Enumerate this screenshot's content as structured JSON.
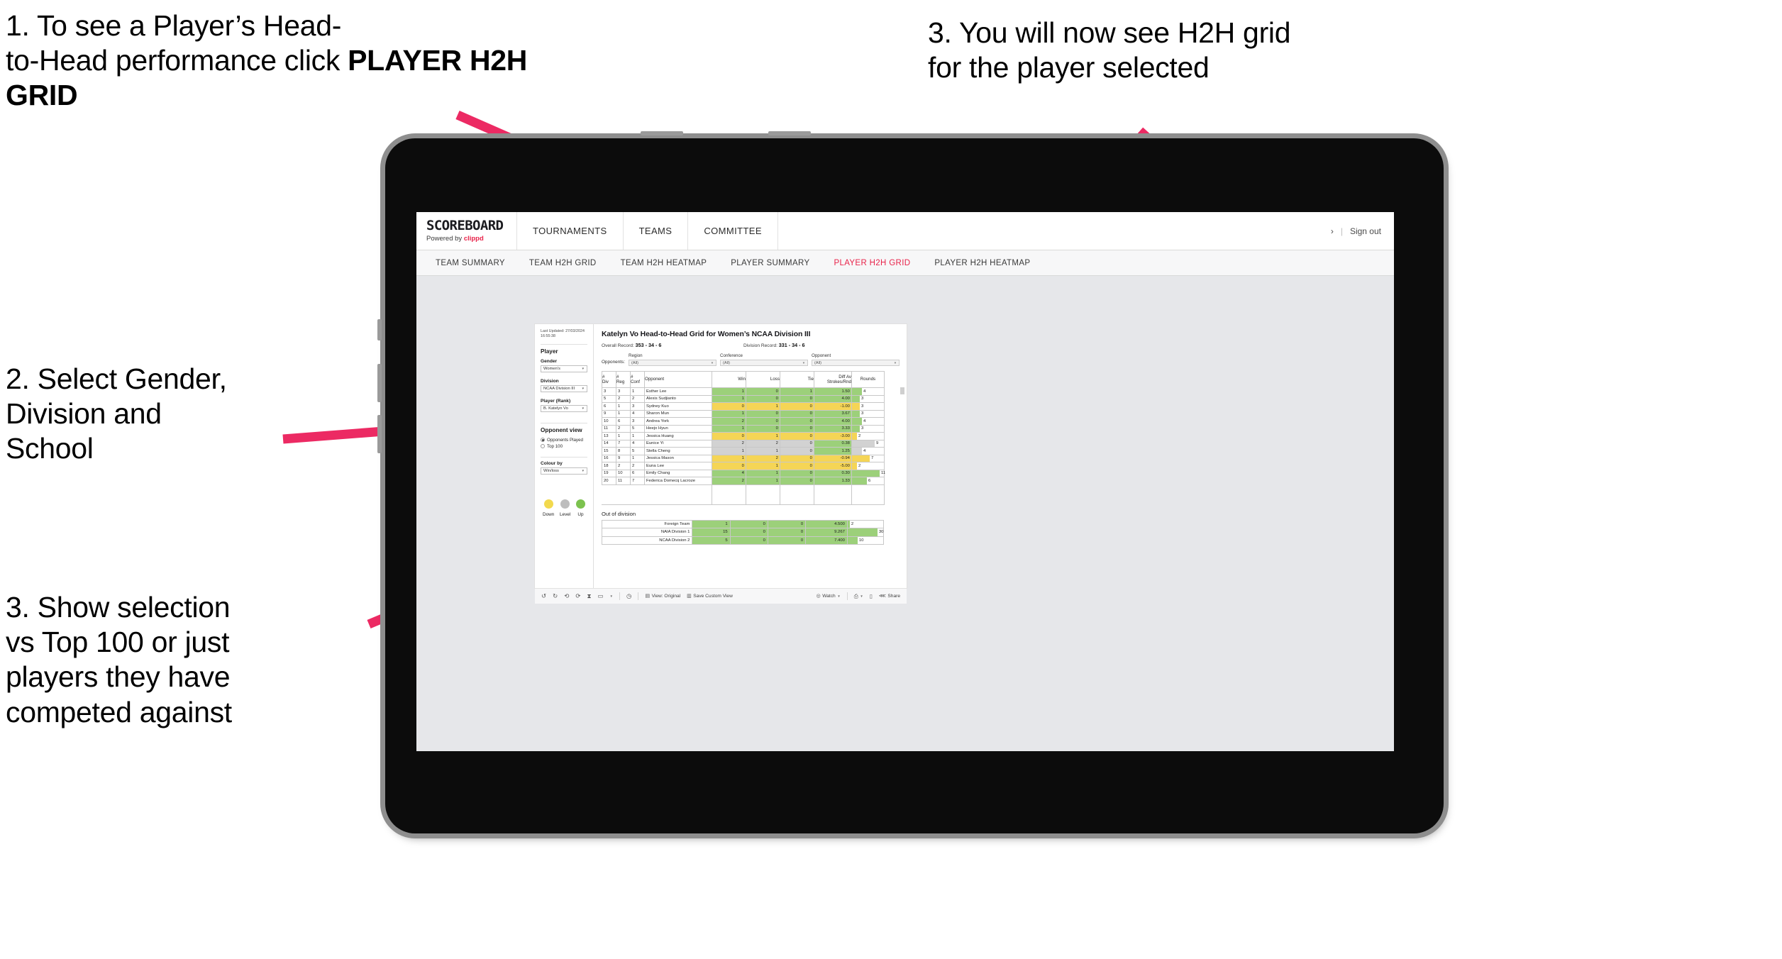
{
  "annotations": {
    "a1_line1": "1. To see a Player’s Head-\nto-Head performance click ",
    "a1_bold": "PLAYER H2H GRID",
    "a2": "2. Select Gender,\nDivision and\nSchool",
    "a3": "3. Show selection\nvs Top 100 or just\nplayers they have\ncompeted against",
    "a4": "3. You will now see H2H grid\nfor the player selected"
  },
  "brand": {
    "name": "SCOREBOARD",
    "powered_prefix": "Powered by ",
    "powered_brand": "clippd"
  },
  "topnav": {
    "items": [
      "TOURNAMENTS",
      "TEAMS",
      "COMMITTEE"
    ],
    "chevron": "›",
    "separator": "|",
    "signout": "Sign out"
  },
  "tabs": [
    {
      "label": "TEAM SUMMARY",
      "active": false
    },
    {
      "label": "TEAM H2H GRID",
      "active": false
    },
    {
      "label": "TEAM H2H HEATMAP",
      "active": false
    },
    {
      "label": "PLAYER SUMMARY",
      "active": false
    },
    {
      "label": "PLAYER H2H GRID",
      "active": true
    },
    {
      "label": "PLAYER H2H HEATMAP",
      "active": false
    }
  ],
  "panel": {
    "last_updated": "Last Updated: 27/03/2024 16:55:38",
    "section_player": "Player",
    "gender_label": "Gender",
    "gender_value": "Women's",
    "division_label": "Division",
    "division_value": "NCAA Division III",
    "player_label": "Player (Rank)",
    "player_value": "B. Katelyn Vo",
    "opponent_view_label": "Opponent view",
    "radio_played": "Opponents Played",
    "radio_top100": "Top 100",
    "colour_by_label": "Colour by",
    "colour_by_value": "Win/loss",
    "legend": [
      {
        "name": "Down",
        "color": "#f2d94e"
      },
      {
        "name": "Level",
        "color": "#bdbdbd"
      },
      {
        "name": "Up",
        "color": "#7cc24f"
      }
    ]
  },
  "viz": {
    "title": "Katelyn Vo Head-to-Head Grid for Women’s NCAA Division III",
    "overall_label": "Overall Record: ",
    "overall_value": "353 - 34 - 6",
    "division_label": "Division Record: ",
    "division_value": "331 - 34 - 6",
    "opponents_label": "Opponents:",
    "filters": [
      {
        "label": "Region",
        "value": "(All)"
      },
      {
        "label": "Conference",
        "value": "(All)"
      },
      {
        "label": "Opponent",
        "value": "(All)"
      }
    ],
    "out_of_division_title": "Out of division"
  },
  "chart_data": {
    "type": "table",
    "title": "Katelyn Vo Head-to-Head Grid for Women’s NCAA Division III",
    "columns": [
      "# Div",
      "# Reg",
      "# Conf",
      "Opponent",
      "Win",
      "Loss",
      "Tie",
      "Diff Av Strokes/Rnd",
      "Rounds"
    ],
    "header_lines": [
      [
        "#",
        "Div"
      ],
      [
        "#",
        "Reg"
      ],
      [
        "#",
        "Conf"
      ],
      [
        "Opponent",
        ""
      ],
      [
        "Win",
        ""
      ],
      [
        "Loss",
        ""
      ],
      [
        "Tie",
        ""
      ],
      [
        "Diff Av",
        "Strokes/Rnd"
      ],
      [
        "Rounds",
        ""
      ]
    ],
    "rounds_max": 13,
    "rows": [
      {
        "div": "3",
        "reg": "3",
        "conf": "1",
        "opponent": "Esther Lee",
        "win": "1",
        "loss": "0",
        "tie": "1",
        "diff": "1.50",
        "rounds": 4,
        "color": "#9cd07a"
      },
      {
        "div": "5",
        "reg": "2",
        "conf": "2",
        "opponent": "Alexis Sudjianto",
        "win": "1",
        "loss": "0",
        "tie": "0",
        "diff": "4.00",
        "rounds": 3,
        "color": "#9cd07a"
      },
      {
        "div": "6",
        "reg": "1",
        "conf": "3",
        "opponent": "Sydney Kuo",
        "win": "0",
        "loss": "1",
        "tie": "0",
        "diff": "-1.00",
        "rounds": 3,
        "color": "#f5d556"
      },
      {
        "div": "9",
        "reg": "1",
        "conf": "4",
        "opponent": "Sharon Mun",
        "win": "1",
        "loss": "0",
        "tie": "0",
        "diff": "3.67",
        "rounds": 3,
        "color": "#9cd07a"
      },
      {
        "div": "10",
        "reg": "6",
        "conf": "3",
        "opponent": "Andrea York",
        "win": "2",
        "loss": "0",
        "tie": "0",
        "diff": "4.00",
        "rounds": 4,
        "color": "#9cd07a"
      },
      {
        "div": "11",
        "reg": "2",
        "conf": "5",
        "opponent": "Heejo Hyun",
        "win": "1",
        "loss": "0",
        "tie": "0",
        "diff": "3.33",
        "rounds": 3,
        "color": "#9cd07a"
      },
      {
        "div": "13",
        "reg": "1",
        "conf": "1",
        "opponent": "Jessica Huang",
        "win": "0",
        "loss": "1",
        "tie": "0",
        "diff": "-3.00",
        "rounds": 2,
        "color": "#f5d556"
      },
      {
        "div": "14",
        "reg": "7",
        "conf": "4",
        "opponent": "Eunice Yi",
        "win": "2",
        "loss": "2",
        "tie": "0",
        "diff": "0.38",
        "rounds": 9,
        "color": "#d2d2d2",
        "diff_color": "#9cd07a"
      },
      {
        "div": "15",
        "reg": "8",
        "conf": "5",
        "opponent": "Stella Cheng",
        "win": "1",
        "loss": "1",
        "tie": "0",
        "diff": "1.25",
        "rounds": 4,
        "color": "#d2d2d2",
        "diff_color": "#9cd07a"
      },
      {
        "div": "16",
        "reg": "9",
        "conf": "1",
        "opponent": "Jessica Mason",
        "win": "1",
        "loss": "2",
        "tie": "0",
        "diff": "-0.94",
        "rounds": 7,
        "color": "#f5d556"
      },
      {
        "div": "18",
        "reg": "2",
        "conf": "2",
        "opponent": "Euna Lee",
        "win": "0",
        "loss": "1",
        "tie": "0",
        "diff": "-5.00",
        "rounds": 2,
        "color": "#f5d556"
      },
      {
        "div": "19",
        "reg": "10",
        "conf": "6",
        "opponent": "Emily Chang",
        "win": "4",
        "loss": "1",
        "tie": "0",
        "diff": "0.30",
        "rounds": 11,
        "color": "#9cd07a"
      },
      {
        "div": "20",
        "reg": "11",
        "conf": "7",
        "opponent": "Federica Domecq Lacroze",
        "win": "2",
        "loss": "1",
        "tie": "0",
        "diff": "1.33",
        "rounds": 6,
        "color": "#9cd07a"
      }
    ],
    "out_of_division": {
      "rounds_max": 33,
      "rows": [
        {
          "name": "Foreign Team",
          "win": "1",
          "loss": "0",
          "tie": "0",
          "diff": "4.500",
          "rounds": 2,
          "color": "#9cd07a"
        },
        {
          "name": "NAIA Division 1",
          "win": "15",
          "loss": "0",
          "tie": "0",
          "diff": "9.267",
          "rounds": 30,
          "color": "#9cd07a"
        },
        {
          "name": "NCAA Division 2",
          "win": "5",
          "loss": "0",
          "tie": "0",
          "diff": "7.400",
          "rounds": 10,
          "color": "#9cd07a"
        }
      ]
    }
  },
  "toolbar": {
    "undo": "undo-icon",
    "redo": "redo-icon",
    "revert": "revert-icon",
    "refresh": "refresh-icon",
    "pause": "pause-icon",
    "highlight": "highlight-icon",
    "history": "history-icon",
    "view_label": "View: Original",
    "save_label": "Save Custom View",
    "watch_label": "Watch",
    "download": "download-icon",
    "device": "device-icon",
    "share_label": "Share"
  },
  "colors": {
    "accent": "#e8234a",
    "green": "#9cd07a",
    "yellow": "#f5d556",
    "grey": "#d2d2d2",
    "arrow": "#ec2a63"
  }
}
